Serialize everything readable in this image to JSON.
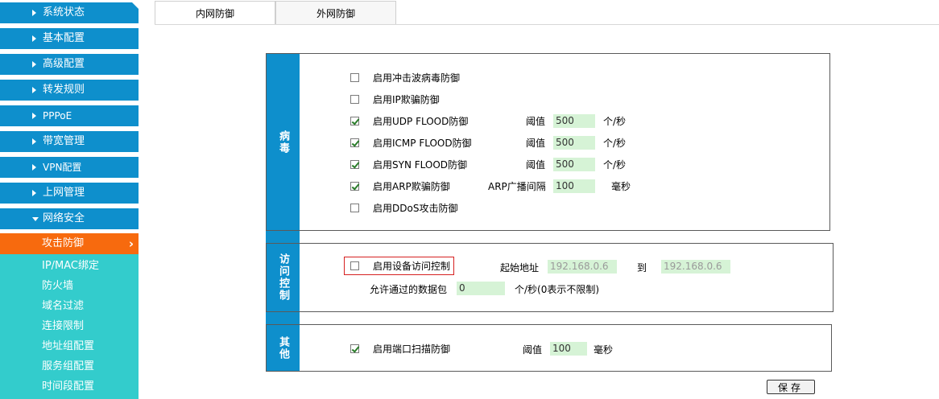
{
  "sidebar": {
    "items": [
      {
        "label": "系统状态"
      },
      {
        "label": "基本配置"
      },
      {
        "label": "高级配置"
      },
      {
        "label": "转发规则"
      },
      {
        "label": "PPPoE"
      },
      {
        "label": "带宽管理"
      },
      {
        "label": "VPN配置"
      },
      {
        "label": "上网管理"
      },
      {
        "label": "网络安全"
      }
    ],
    "active_sub": "攻击防御",
    "active_chevron": "›",
    "sub_items": [
      {
        "label": "IP/MAC绑定"
      },
      {
        "label": "防火墙"
      },
      {
        "label": "域名过滤"
      },
      {
        "label": "连接限制"
      },
      {
        "label": "地址组配置"
      },
      {
        "label": "服务组配置"
      },
      {
        "label": "时间段配置"
      }
    ]
  },
  "tabs": {
    "internal": "内网防御",
    "external": "外网防御"
  },
  "virus": {
    "label": "病毒",
    "shockwave": {
      "label": "启用冲击波病毒防御",
      "checked": false
    },
    "ip_spoof": {
      "label": "启用IP欺骗防御",
      "checked": false
    },
    "udp": {
      "label": "启用UDP FLOOD防御",
      "checked": true,
      "threshold_label": "阈值",
      "value": "500",
      "unit": "个/秒"
    },
    "icmp": {
      "label": "启用ICMP FLOOD防御",
      "checked": true,
      "threshold_label": "阈值",
      "value": "500",
      "unit": "个/秒"
    },
    "syn": {
      "label": "启用SYN FLOOD防御",
      "checked": true,
      "threshold_label": "阈值",
      "value": "500",
      "unit": "个/秒"
    },
    "arp": {
      "label": "启用ARP欺骗防御",
      "checked": true,
      "threshold_label": "ARP广播间隔",
      "value": "100",
      "unit": "毫秒"
    },
    "ddos": {
      "label": "启用DDoS攻击防御",
      "checked": false
    }
  },
  "access": {
    "label": "访问控制",
    "enable": {
      "label": "启用设备访问控制",
      "checked": false
    },
    "start_label": "起始地址",
    "start_value": "192.168.0.6",
    "to_label": "到",
    "end_value": "192.168.0.6",
    "packets_label": "允许通过的数据包",
    "packets_value": "0",
    "packets_unit": "个/秒(0表示不限制)"
  },
  "other": {
    "label": "其他",
    "portscan": {
      "label": "启用端口扫描防御",
      "checked": true,
      "threshold_label": "阈值",
      "value": "100",
      "unit": "毫秒"
    }
  },
  "save_label": "保存",
  "colors": {
    "menu_blue": "#0e8fcc",
    "active_orange": "#f76a0e",
    "submenu_teal": "#33cccc",
    "field_green": "#d6f3d6",
    "highlight_red": "#d62020"
  }
}
